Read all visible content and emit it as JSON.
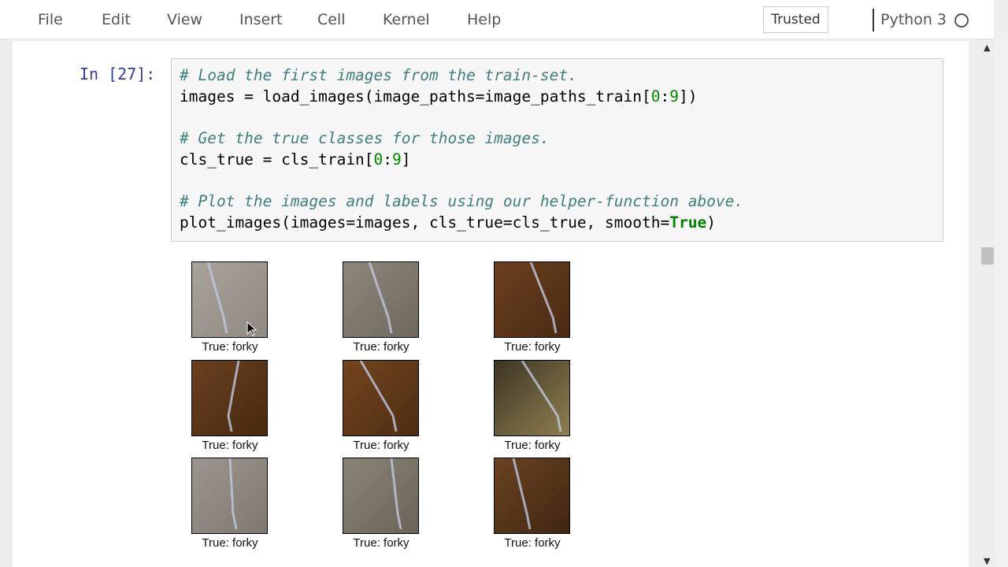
{
  "menu": {
    "items": [
      "File",
      "Edit",
      "View",
      "Insert",
      "Cell",
      "Kernel",
      "Help"
    ],
    "trusted_label": "Trusted",
    "kernel_name": "Python 3"
  },
  "cell": {
    "prompt": "In [27]:",
    "code": [
      "# Load the first images from the train-set.",
      "images = load_images(image_paths=image_paths_train[0:9])",
      "",
      "# Get the true classes for those images.",
      "cls_true = cls_train[0:9]",
      "",
      "# Plot the images and labels using our helper-function above.",
      "plot_images(images=images, cls_true=cls_true, smooth=True)"
    ]
  },
  "output": {
    "images": [
      {
        "label": "True: forky",
        "colors": [
          "#a9a39a",
          "#8f8a82"
        ]
      },
      {
        "label": "True: forky",
        "colors": [
          "#8e877b",
          "#6f685d"
        ]
      },
      {
        "label": "True: forky",
        "colors": [
          "#6b3f1f",
          "#4a2a12"
        ]
      },
      {
        "label": "True: forky",
        "colors": [
          "#6a4020",
          "#47290f"
        ]
      },
      {
        "label": "True: forky",
        "colors": [
          "#73451f",
          "#4d2d12"
        ]
      },
      {
        "label": "True: forky",
        "colors": [
          "#3d3524",
          "#8f8050"
        ]
      },
      {
        "label": "True: forky",
        "colors": [
          "#9c9690",
          "#7f786f"
        ]
      },
      {
        "label": "True: forky",
        "colors": [
          "#8a8478",
          "#6b6358"
        ]
      },
      {
        "label": "True: forky",
        "colors": [
          "#6a4322",
          "#3f2710"
        ]
      }
    ]
  }
}
